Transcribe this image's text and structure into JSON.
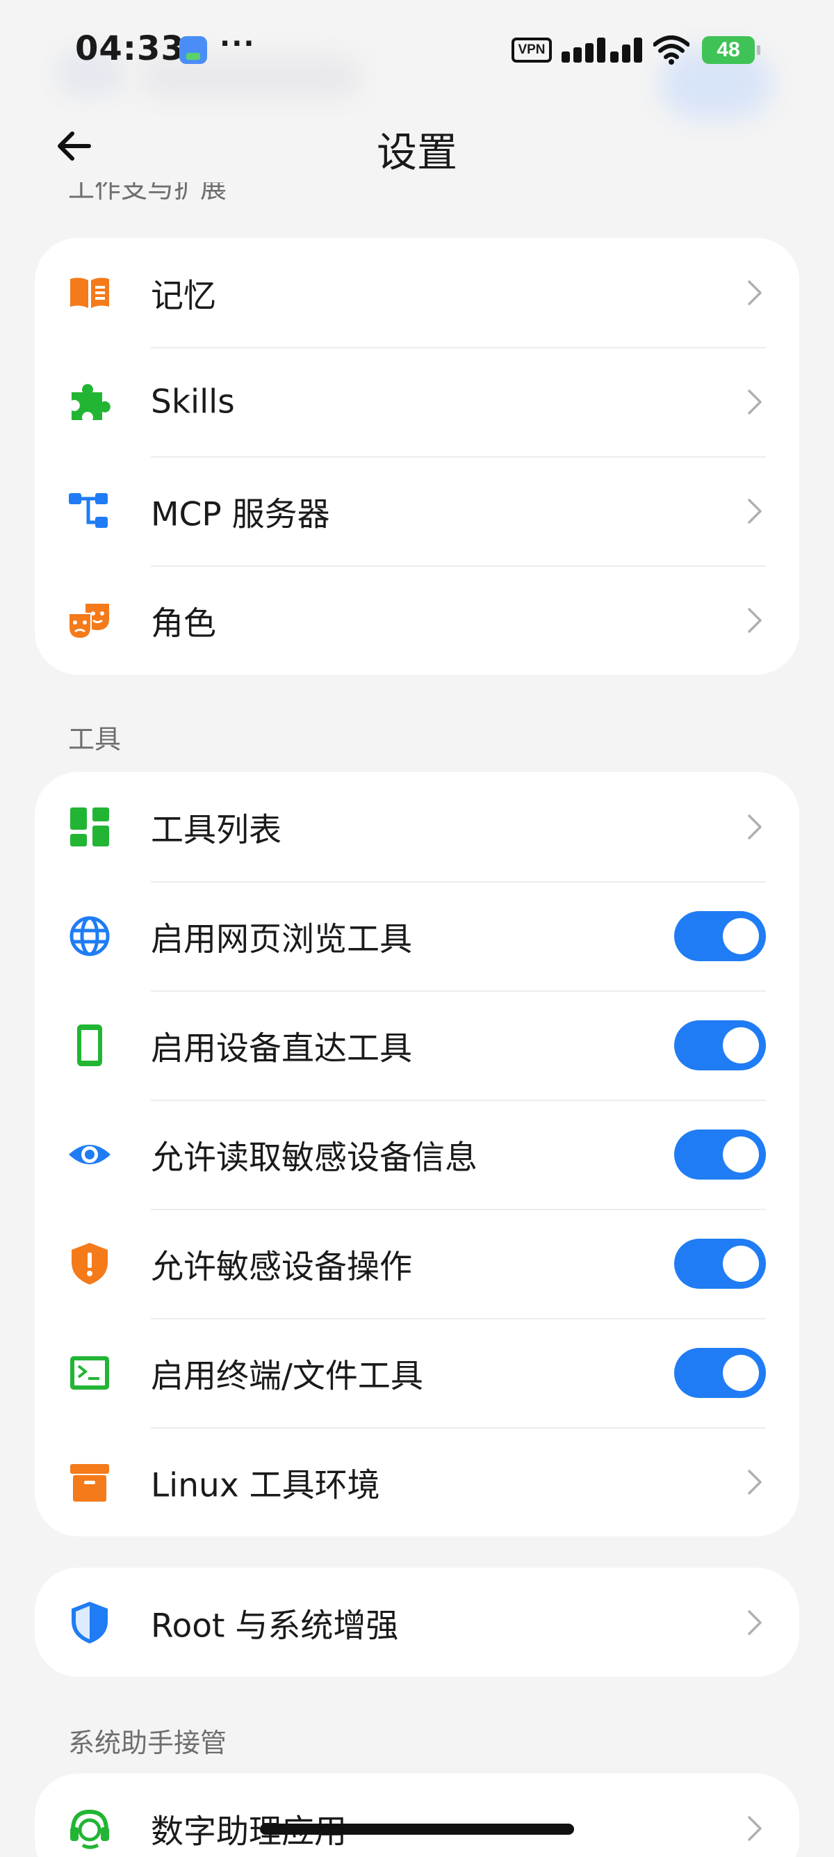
{
  "status_bar": {
    "time": "04:33",
    "more": "···",
    "vpn": "VPN",
    "battery": "48",
    "icons": [
      "app-icon",
      "signal-icon",
      "wifi-icon",
      "battery-charging-icon"
    ]
  },
  "header": {
    "title": "设置",
    "back_icon": "arrow-left-icon"
  },
  "section_work": {
    "title": "工作支与扩展",
    "items": [
      {
        "label": "记忆",
        "icon": "book-icon",
        "color": "#f47a1a",
        "control": "chevron"
      },
      {
        "label": "Skills",
        "icon": "puzzle-icon",
        "color": "#22b534",
        "control": "chevron"
      },
      {
        "label": "MCP 服务器",
        "icon": "hierarchy-icon",
        "color": "#1f7cf4",
        "control": "chevron"
      },
      {
        "label": "角色",
        "icon": "theater-masks-icon",
        "color": "#f47a1a",
        "control": "chevron"
      }
    ]
  },
  "section_tools": {
    "title": "工具",
    "items": [
      {
        "label": "工具列表",
        "icon": "dashboard-icon",
        "color": "#22b534",
        "control": "chevron"
      },
      {
        "label": "启用网页浏览工具",
        "icon": "globe-icon",
        "color": "#1f7cf4",
        "control": "toggle",
        "enabled": true
      },
      {
        "label": "启用设备直达工具",
        "icon": "phone-icon",
        "color": "#22b534",
        "control": "toggle",
        "enabled": true
      },
      {
        "label": "允许读取敏感设备信息",
        "icon": "eye-icon",
        "color": "#1f7cf4",
        "control": "toggle",
        "enabled": true
      },
      {
        "label": "允许敏感设备操作",
        "icon": "shield-alert-icon",
        "color": "#f47a1a",
        "control": "toggle",
        "enabled": true
      },
      {
        "label": "启用终端/文件工具",
        "icon": "terminal-icon",
        "color": "#22b534",
        "control": "toggle",
        "enabled": true
      },
      {
        "label": "Linux 工具环境",
        "icon": "archive-box-icon",
        "color": "#f47a1a",
        "control": "chevron"
      }
    ]
  },
  "section_root": {
    "items": [
      {
        "label": "Root 与系统增强",
        "icon": "shield-check-icon",
        "color": "#1f7cf4",
        "control": "chevron"
      }
    ]
  },
  "section_assistant": {
    "title": "系统助手接管",
    "items": [
      {
        "label": "数字助理应用",
        "icon": "headset-icon",
        "color": "#22b534",
        "control": "chevron"
      }
    ]
  },
  "colors": {
    "accent_blue": "#1f7cf4",
    "accent_green": "#22b534",
    "accent_orange": "#f47a1a",
    "page_background": "#f4f4f4",
    "card_background": "#ffffff"
  }
}
